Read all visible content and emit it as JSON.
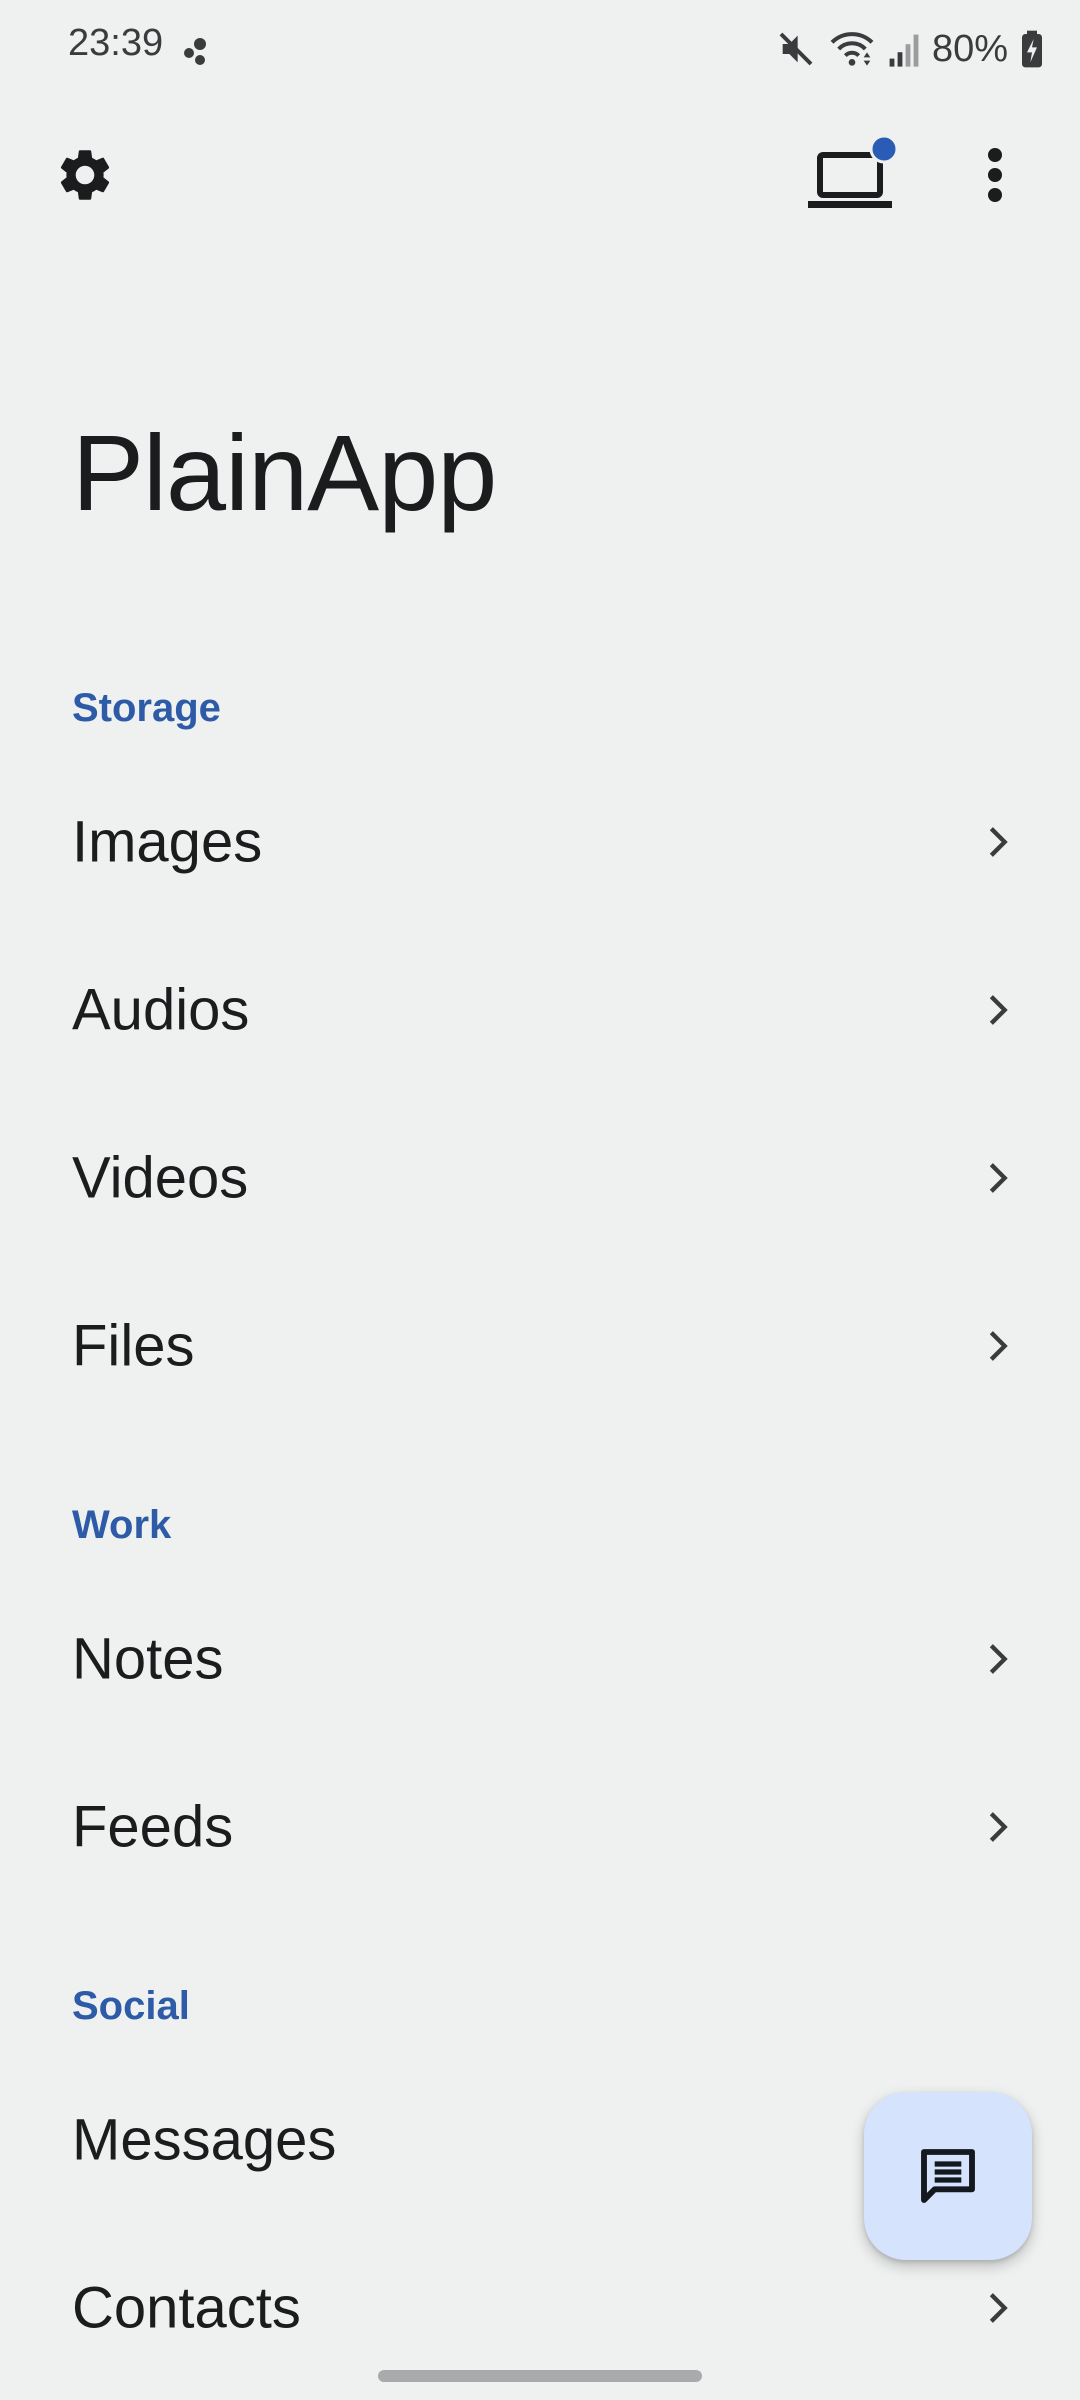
{
  "status_bar": {
    "time": "23:39",
    "battery_percent": "80%",
    "icons": [
      "notification-dots-icon",
      "mute-icon",
      "wifi-icon",
      "signal-icon",
      "battery-charging-icon"
    ]
  },
  "toolbar": {
    "settings_icon": "gear-icon",
    "web_console_icon": "laptop-icon",
    "web_console_badge_color": "#2a5bb5",
    "more_icon": "more-vert-icon"
  },
  "app": {
    "title": "PlainApp"
  },
  "sections": {
    "storage": {
      "header": "Storage",
      "items": [
        "Images",
        "Audios",
        "Videos",
        "Files"
      ]
    },
    "work": {
      "header": "Work",
      "items": [
        "Notes",
        "Feeds"
      ]
    },
    "social": {
      "header": "Social",
      "items": [
        "Messages",
        "Contacts"
      ]
    }
  },
  "fab": {
    "icon": "chat-icon",
    "background": "#d6e3fc"
  },
  "colors": {
    "background": "#eff1f0",
    "section_accent": "#2e5ba7",
    "text_primary": "#1b1c1d"
  }
}
